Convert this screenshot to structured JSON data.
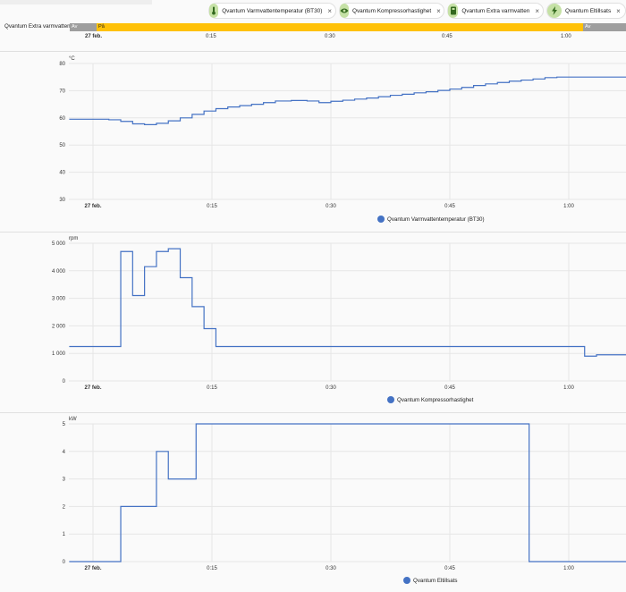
{
  "chips": [
    {
      "label": "Qvantum Varmvattentemperatur (BT30)",
      "icon": "thermometer-icon",
      "close": "×"
    },
    {
      "label": "Qvantum Kompressorhastighet",
      "icon": "eye-icon",
      "close": "×"
    },
    {
      "label": "Qvantum Extra varmvatten",
      "icon": "water-heater-icon",
      "close": "×"
    },
    {
      "label": "Qvantum Eltillsats",
      "icon": "lightning-icon",
      "close": "×"
    }
  ],
  "timeline": {
    "label": "Qvantum Extra varmvatten",
    "segments": [
      {
        "label": "Av",
        "color": "#9e9e9e"
      },
      {
        "label": "På",
        "color": "#ffc107"
      },
      {
        "label": "Av",
        "color": "#9e9e9e"
      }
    ]
  },
  "x_ticks": [
    "27 feb.",
    "0:15",
    "0:30",
    "0:45",
    "1:00"
  ],
  "series_color": "#4472c4",
  "chart_data": [
    {
      "type": "line",
      "title": "",
      "ylabel": "°C",
      "ylim": [
        30,
        80
      ],
      "yticks": [
        "80",
        "70",
        "60",
        "50",
        "40",
        "30"
      ],
      "ytick_values": [
        80,
        70,
        60,
        50,
        40,
        30
      ],
      "legend": "Qvantum Varmvattentemperatur (BT30)",
      "step": true,
      "x_unit": "minutes after 27 feb. 00:00",
      "x": [
        -3,
        2,
        3.5,
        5,
        6.5,
        8,
        9.5,
        11,
        12.5,
        14,
        15.5,
        17,
        18.5,
        20,
        21.5,
        23,
        25,
        27,
        28.5,
        30,
        31.5,
        33,
        34.5,
        36,
        37.5,
        39,
        40.5,
        42,
        43.5,
        45,
        46.5,
        48,
        49.5,
        51,
        52.5,
        54,
        55.5,
        57,
        58.5,
        63.5
      ],
      "values": [
        59.5,
        59.3,
        58.7,
        57.8,
        57.5,
        58,
        58.9,
        60,
        61.3,
        62.5,
        63.4,
        64,
        64.5,
        65,
        65.6,
        66.2,
        66.4,
        66.2,
        65.6,
        66.1,
        66.5,
        66.9,
        67.3,
        67.8,
        68.3,
        68.7,
        69.2,
        69.6,
        70.1,
        70.6,
        71.2,
        71.9,
        72.5,
        73,
        73.5,
        73.9,
        74.3,
        74.8,
        75,
        75
      ]
    },
    {
      "type": "line",
      "title": "",
      "ylabel": "rpm",
      "ylim": [
        0,
        5000
      ],
      "yticks": [
        "5 000",
        "4 000",
        "3 000",
        "2 000",
        "1 000",
        "0"
      ],
      "ytick_values": [
        5000,
        4000,
        3000,
        2000,
        1000,
        0
      ],
      "legend": "Qvantum Kompressorhastighet",
      "step": true,
      "x_unit": "minutes after 27 feb. 00:00",
      "x": [
        -3,
        2,
        3.5,
        5,
        6.5,
        8,
        9.5,
        11,
        12.5,
        14,
        15.5,
        62,
        63.5
      ],
      "values": [
        1250,
        1250,
        4700,
        3100,
        4150,
        4700,
        4800,
        3750,
        2700,
        1900,
        1250,
        900,
        950
      ]
    },
    {
      "type": "line",
      "title": "",
      "ylabel": "kW",
      "ylim": [
        0,
        5
      ],
      "yticks": [
        "5",
        "4",
        "3",
        "2",
        "1",
        "0"
      ],
      "ytick_values": [
        5,
        4,
        3,
        2,
        1,
        0
      ],
      "legend": "Qvantum Eltillsats",
      "step": true,
      "x_unit": "minutes after 27 feb. 00:00",
      "x": [
        -3,
        3.5,
        8,
        9.5,
        13,
        55,
        63.5
      ],
      "values": [
        0,
        2,
        4,
        3,
        5,
        0,
        0
      ]
    }
  ]
}
